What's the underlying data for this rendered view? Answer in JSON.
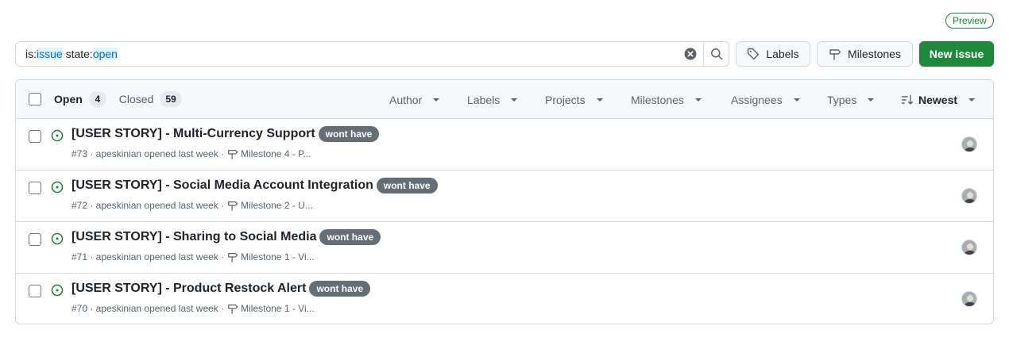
{
  "preview_badge": "Preview",
  "search": {
    "prefix1": "is:",
    "value1": "issue",
    "prefix2": " state:",
    "value2": "open"
  },
  "buttons": {
    "labels": "Labels",
    "milestones": "Milestones",
    "new_issue": "New issue"
  },
  "tabs": {
    "open_label": "Open",
    "open_count": "4",
    "closed_label": "Closed",
    "closed_count": "59"
  },
  "filters": {
    "author": "Author",
    "labels": "Labels",
    "projects": "Projects",
    "milestones": "Milestones",
    "assignees": "Assignees",
    "types": "Types",
    "sort": "Newest"
  },
  "issues": [
    {
      "title": "[USER STORY] - Multi-Currency Support",
      "label": "wont have",
      "meta": "#73 · apeskinian opened last week ·",
      "milestone": "Milestone 4 - P..."
    },
    {
      "title": "[USER STORY] - Social Media Account Integration",
      "label": "wont have",
      "meta": "#72 · apeskinian opened last week ·",
      "milestone": "Milestone 2 - U..."
    },
    {
      "title": "[USER STORY] - Sharing to Social Media",
      "label": "wont have",
      "meta": "#71 · apeskinian opened last week ·",
      "milestone": "Milestone 1 - Vi..."
    },
    {
      "title": "[USER STORY] - Product Restock Alert",
      "label": "wont have",
      "meta": "#70 · apeskinian opened last week ·",
      "milestone": "Milestone 1 - Vi..."
    }
  ],
  "colors": {
    "open_icon": "#1a7f37",
    "primary_button": "#1f883d",
    "label_bg": "#656d76",
    "search_highlight": "#0969da"
  }
}
